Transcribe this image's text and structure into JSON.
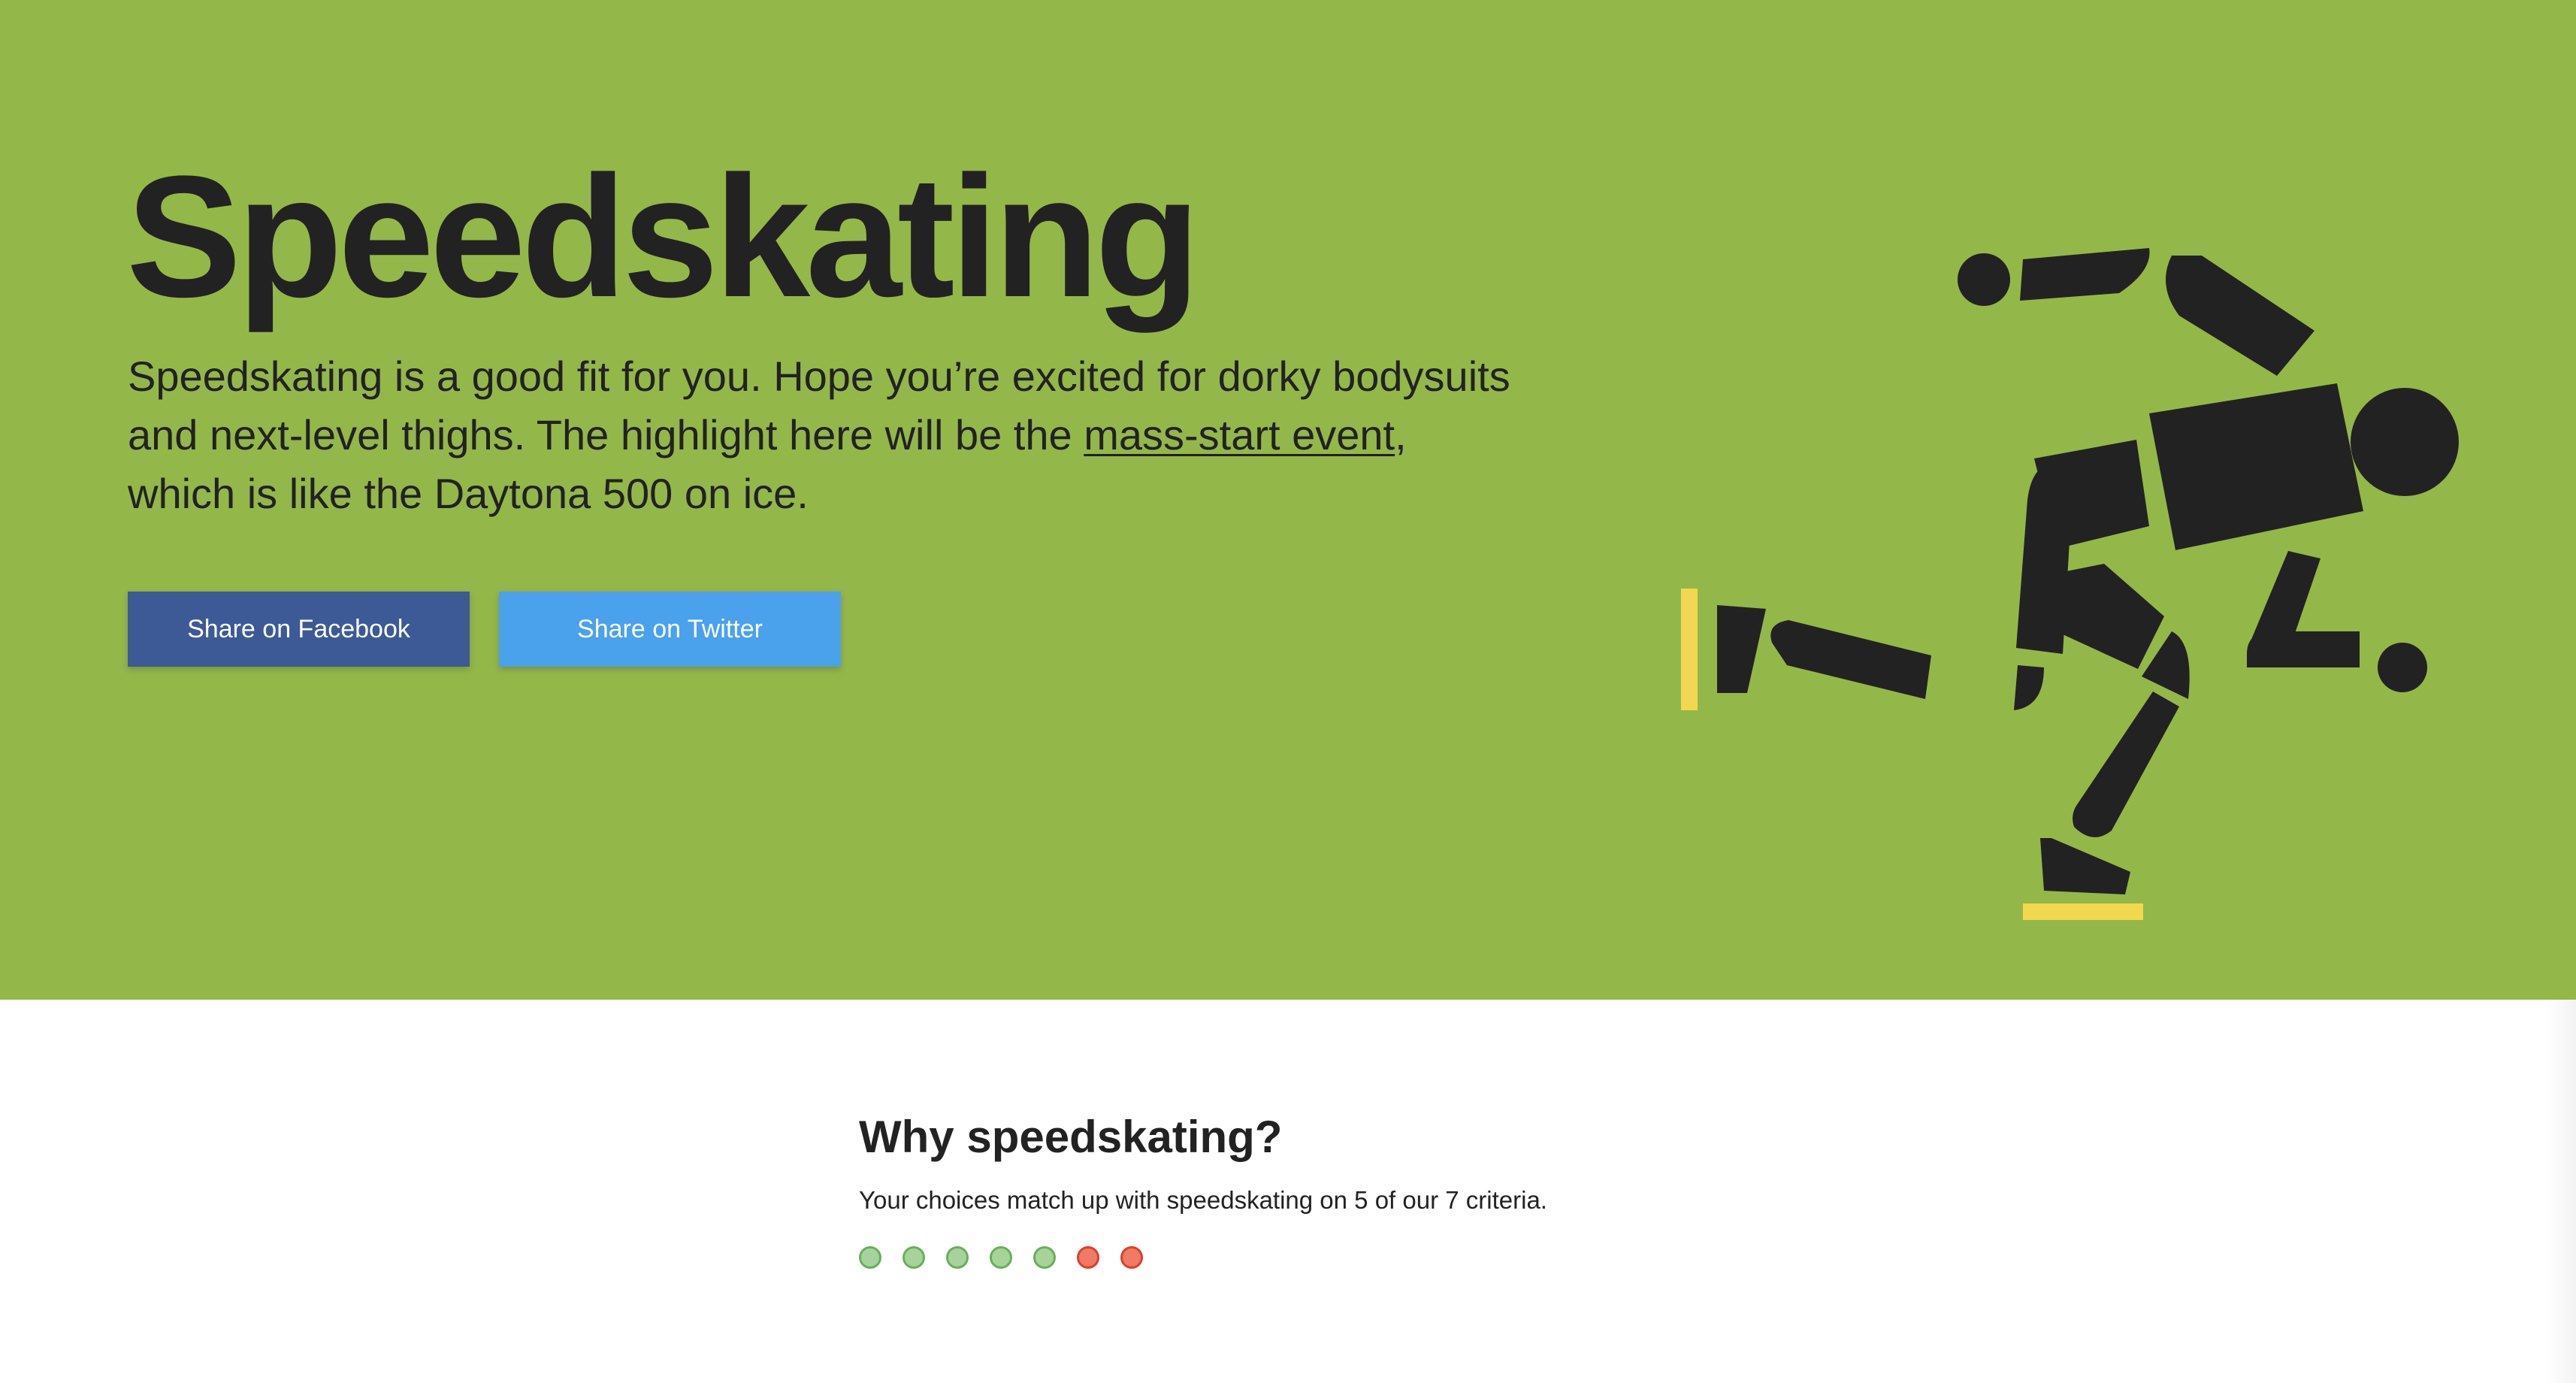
{
  "hero": {
    "title": "Speedskating",
    "description_before": "Speedskating is a good fit for you. Hope you’re excited for dorky bodysuits and next-level thighs. The highlight here will be the ",
    "link_text": "mass-start event",
    "description_after": ", which is like the Daytona 500 on ice.",
    "background_color": "#94b74a",
    "illustration": "speedskater-icon"
  },
  "share": {
    "facebook_label": "Share on Facebook",
    "twitter_label": "Share on Twitter",
    "facebook_color": "#3d5a96",
    "twitter_color": "#4aa1ec"
  },
  "why": {
    "title": "Why speedskating?",
    "subtitle": "Your choices match up with speedskating on 5 of our 7 criteria.",
    "criteria": [
      "match",
      "match",
      "match",
      "match",
      "match",
      "miss",
      "miss"
    ],
    "match_color": "#a7d39b",
    "miss_color": "#f07a64"
  }
}
